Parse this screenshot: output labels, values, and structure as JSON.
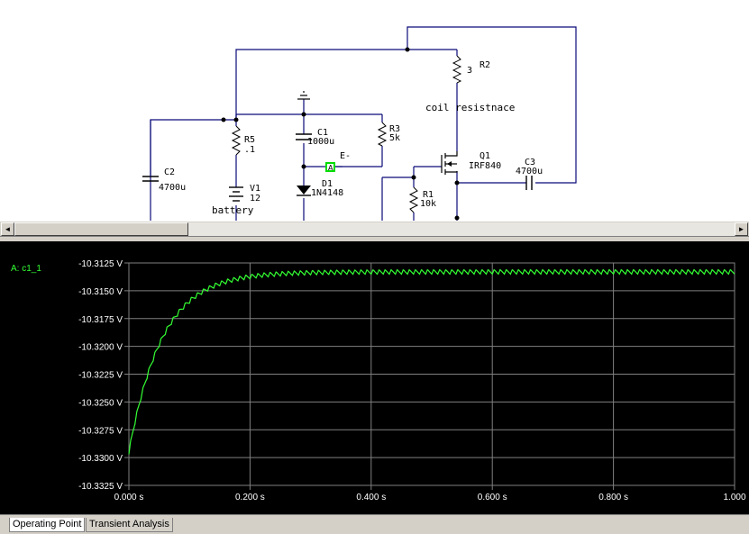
{
  "schematic": {
    "components": {
      "r2": {
        "name": "R2",
        "value": "3"
      },
      "coil": {
        "label": "coil resistnace"
      },
      "c2": {
        "name": "C2",
        "value": "4700u"
      },
      "r5": {
        "name": "R5",
        "value": ".1"
      },
      "v1": {
        "name": "V1",
        "value": "12",
        "label": "battery"
      },
      "c1": {
        "name": "C1",
        "value": "1000u"
      },
      "r3": {
        "name": "R3",
        "value": "5k"
      },
      "probe": {
        "marker": "A",
        "net": "E-"
      },
      "d1": {
        "name": "D1",
        "value": "1N4148"
      },
      "q1": {
        "name": "Q1",
        "value": "IRF840"
      },
      "c3": {
        "name": "C3",
        "value": "4700u"
      },
      "r1": {
        "name": "R1",
        "value": "10k"
      }
    }
  },
  "scrollbar": {
    "left_arrow": "◄",
    "right_arrow": "►"
  },
  "plot": {
    "trace_label": "A: c1_1",
    "colors": {
      "background": "#000000",
      "grid": "#808080",
      "trace": "#33ff33",
      "text": "#ffffff"
    }
  },
  "chart_data": {
    "type": "line",
    "title": "",
    "series": [
      {
        "name": "A: c1_1"
      }
    ],
    "xlim": [
      0,
      1.0
    ],
    "ylim": [
      -10.3325,
      -10.3125
    ],
    "x_ticks": [
      "0.000 s",
      "0.200 s",
      "0.400 s",
      "0.600 s",
      "0.800 s",
      "1.000"
    ],
    "y_ticks": [
      "-10.3125 V",
      "-10.3150 V",
      "-10.3175 V",
      "-10.3200 V",
      "-10.3225 V",
      "-10.3250 V",
      "-10.3275 V",
      "-10.3300 V",
      "-10.3325 V"
    ],
    "grid": true,
    "waveform": {
      "start": -10.3295,
      "settle": -10.3133,
      "time_constant_s": 0.055,
      "ripple_period_s": 0.01,
      "ripple_amplitude_v": 0.0004
    }
  },
  "tabs": [
    {
      "label": "Operating Point",
      "active": true
    },
    {
      "label": "Transient Analysis",
      "active": false
    }
  ]
}
